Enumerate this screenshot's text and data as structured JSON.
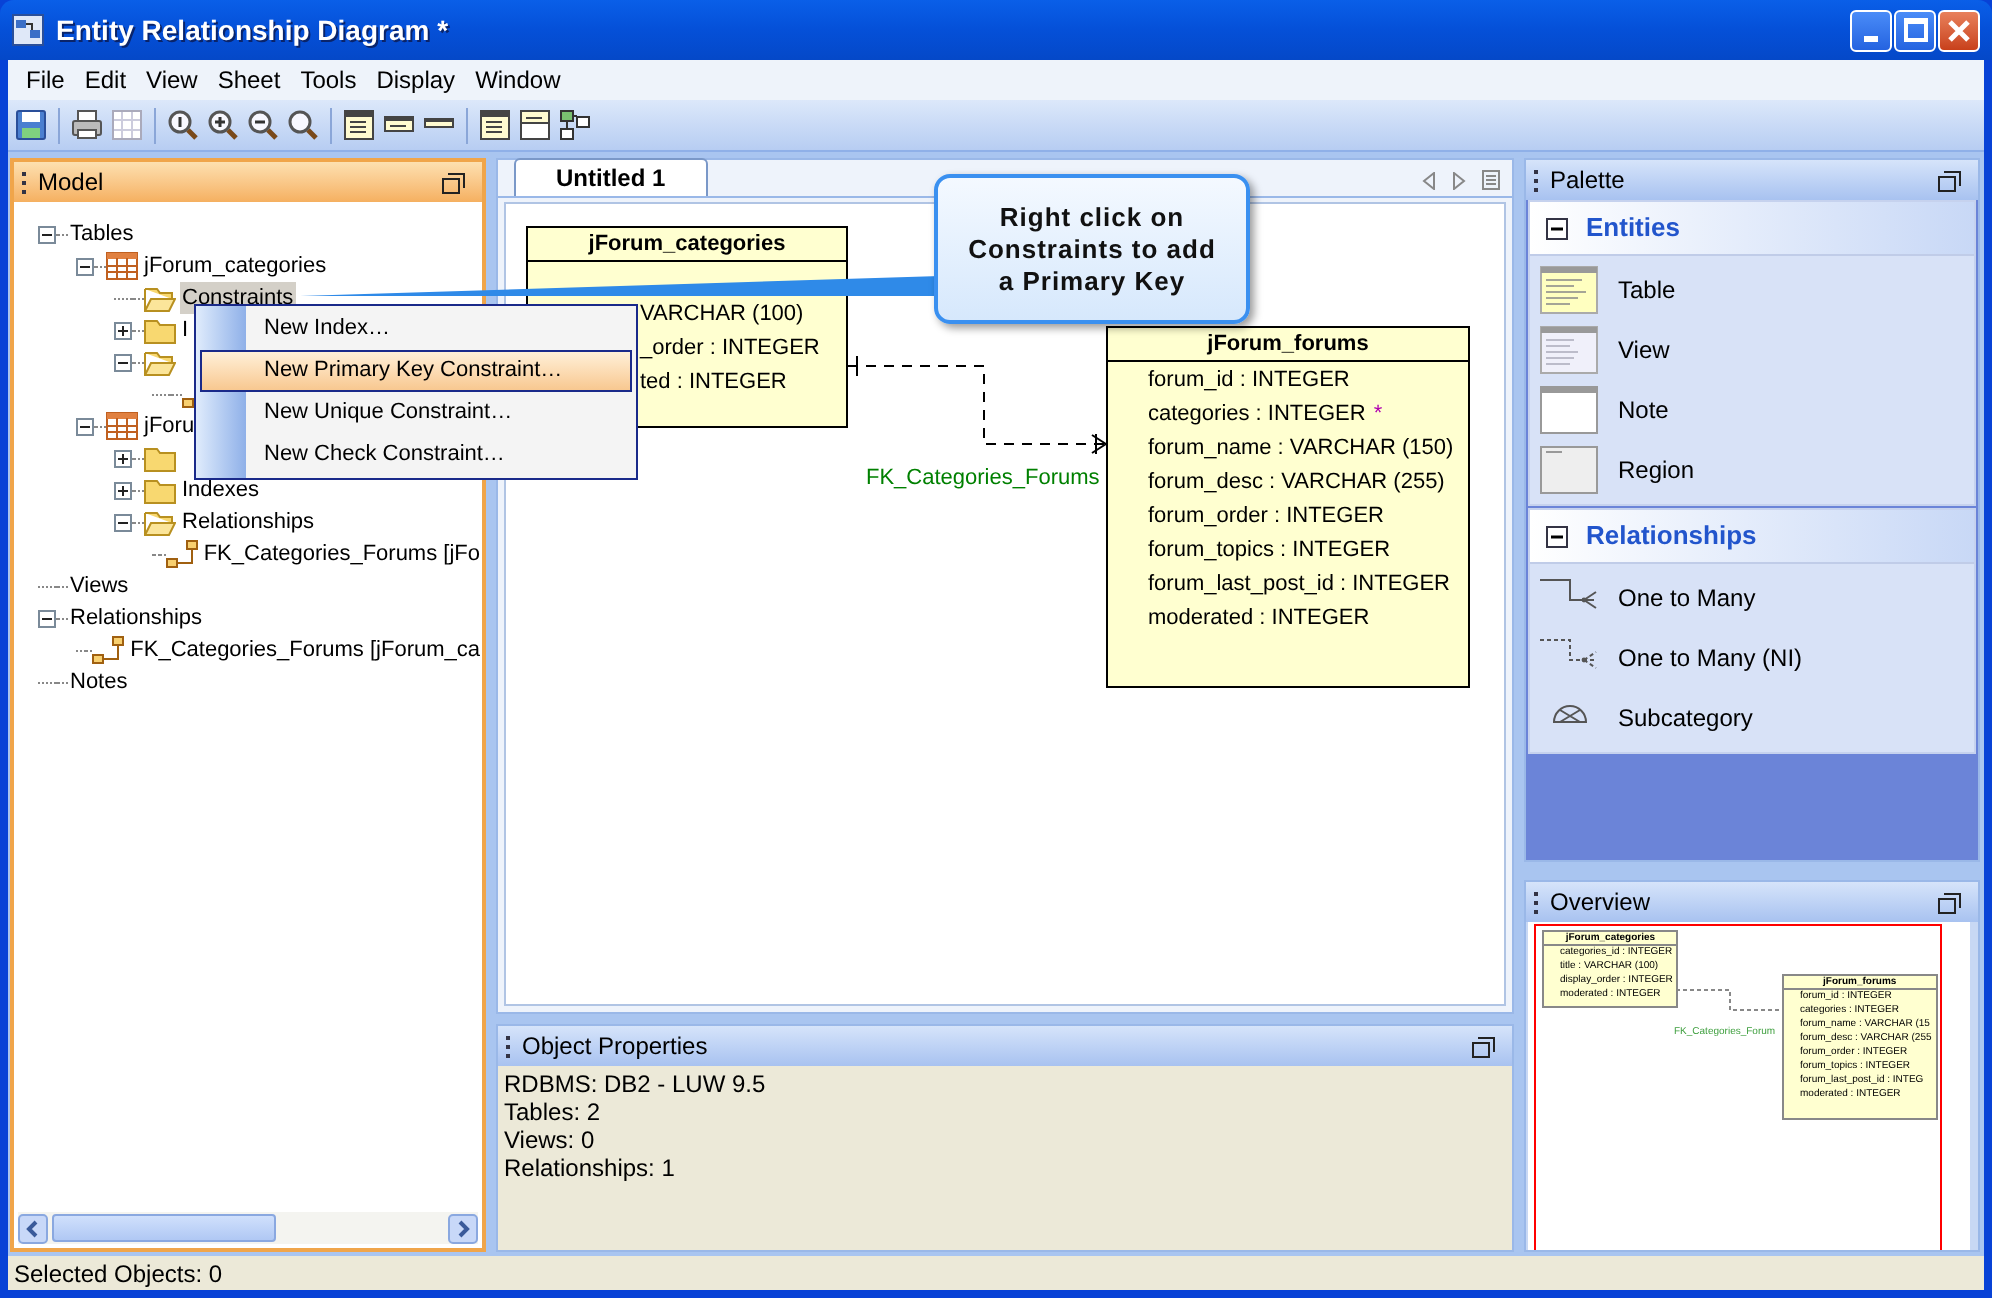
{
  "window": {
    "title": "Entity Relationship Diagram *"
  },
  "menu": [
    {
      "label": "File"
    },
    {
      "label": "Edit"
    },
    {
      "label": "View"
    },
    {
      "label": "Sheet"
    },
    {
      "label": "Tools"
    },
    {
      "label": "Display"
    },
    {
      "label": "Window"
    }
  ],
  "toolbar": [
    {
      "kind": "save"
    },
    {
      "kind": "separator"
    },
    {
      "kind": "print"
    },
    {
      "kind": "grid"
    },
    {
      "kind": "separator"
    },
    {
      "kind": "zoom-actual"
    },
    {
      "kind": "zoom-in"
    },
    {
      "kind": "zoom-out"
    },
    {
      "kind": "zoom-fit"
    },
    {
      "kind": "separator"
    },
    {
      "kind": "table-full"
    },
    {
      "kind": "table-header"
    },
    {
      "kind": "table-title"
    },
    {
      "kind": "separator"
    },
    {
      "kind": "table-full"
    },
    {
      "kind": "table-name"
    },
    {
      "kind": "layout"
    }
  ],
  "model_panel": {
    "title": "Model",
    "tree": [
      {
        "label": "Tables",
        "expanded": true,
        "selected": false,
        "children": [
          {
            "label": "jForum_categories",
            "kind": "table",
            "expanded": true,
            "selected": false,
            "children": [
              {
                "label": "Constraints",
                "kind": "open-folder",
                "selected": true
              },
              {
                "label": "I",
                "kind": "folder",
                "expanded": false,
                "selected": false
              },
              {
                "kind": "open-folder",
                "expanded": true,
                "selected": false,
                "children": [
                  {
                    "kind": "relationship",
                    "selected": false
                  }
                ]
              }
            ]
          },
          {
            "label": "jForu",
            "kind": "table",
            "expanded": true,
            "selected": false,
            "children": [
              {
                "kind": "folder",
                "expanded": false,
                "selected": false
              },
              {
                "label": "Indexes",
                "kind": "folder",
                "expanded": false,
                "selected": false
              },
              {
                "label": "Relationships",
                "kind": "open-folder",
                "expanded": true,
                "selected": false,
                "children": [
                  {
                    "label": "FK_Categories_Forums [jFo",
                    "kind": "relationship",
                    "selected": false
                  }
                ]
              }
            ]
          }
        ]
      },
      {
        "label": "Views",
        "selected": false
      },
      {
        "label": "Relationships",
        "expanded": true,
        "selected": false,
        "children": [
          {
            "label": "FK_Categories_Forums [jForum_ca",
            "kind": "relationship",
            "selected": false
          }
        ]
      },
      {
        "label": "Notes",
        "selected": false
      }
    ]
  },
  "context_menu": {
    "items": [
      {
        "label": "New Index…",
        "selected": false
      },
      {
        "label": "New Primary Key Constraint…",
        "selected": true
      },
      {
        "label": "New Unique Constraint…",
        "selected": false
      },
      {
        "label": "New Check Constraint…",
        "selected": false
      }
    ]
  },
  "callout": {
    "text": "Right click on Constraints to add a Primary Key"
  },
  "editor": {
    "tabs": [
      {
        "label": "Untitled 1",
        "selected": true
      }
    ],
    "entities": [
      {
        "name": "jForum_categories",
        "columns": [
          {
            "text": "VARCHAR (100)"
          },
          {
            "text": "_order : INTEGER"
          },
          {
            "text": "ted : INTEGER"
          }
        ]
      },
      {
        "name": "jForum_forums",
        "columns": [
          {
            "text": "forum_id : INTEGER"
          },
          {
            "text": "categories : INTEGER",
            "marker": "*"
          },
          {
            "text": "forum_name : VARCHAR (150)"
          },
          {
            "text": "forum_desc : VARCHAR (255)"
          },
          {
            "text": "forum_order : INTEGER"
          },
          {
            "text": "forum_topics : INTEGER"
          },
          {
            "text": "forum_last_post_id : INTEGER"
          },
          {
            "text": "moderated : INTEGER"
          }
        ]
      }
    ],
    "relationship_label": "FK_Categories_Forums"
  },
  "object_properties": {
    "title": "Object Properties",
    "lines": [
      "RDBMS: DB2 - LUW 9.5",
      "Tables: 2",
      "Views: 0",
      "Relationships: 1"
    ]
  },
  "palette": {
    "title": "Palette",
    "sections": [
      {
        "title": "Entities",
        "expanded": true,
        "items": [
          {
            "label": "Table",
            "kind": "table"
          },
          {
            "label": "View",
            "kind": "view"
          },
          {
            "label": "Note",
            "kind": "note"
          },
          {
            "label": "Region",
            "kind": "region"
          }
        ]
      },
      {
        "title": "Relationships",
        "expanded": true,
        "items": [
          {
            "label": "One to Many",
            "kind": "one-to-many"
          },
          {
            "label": "One to Many (NI)",
            "kind": "one-to-many-ni"
          },
          {
            "label": "Subcategory",
            "kind": "subcategory"
          }
        ]
      }
    ]
  },
  "overview": {
    "title": "Overview",
    "entities": [
      {
        "name": "jForum_categories",
        "columns": [
          "categories_id : INTEGER",
          "title : VARCHAR (100)",
          "display_order : INTEGER",
          "moderated : INTEGER"
        ]
      },
      {
        "name": "jForum_forums",
        "columns": [
          "forum_id : INTEGER",
          "categories : INTEGER",
          "forum_name : VARCHAR (15",
          "forum_desc : VARCHAR (255",
          "forum_order : INTEGER",
          "forum_topics : INTEGER",
          "forum_last_post_id : INTEG",
          "moderated : INTEGER"
        ]
      }
    ],
    "relationship_label": "FK_Categories_Forum"
  },
  "status_bar": {
    "text": "Selected Objects: 0"
  }
}
